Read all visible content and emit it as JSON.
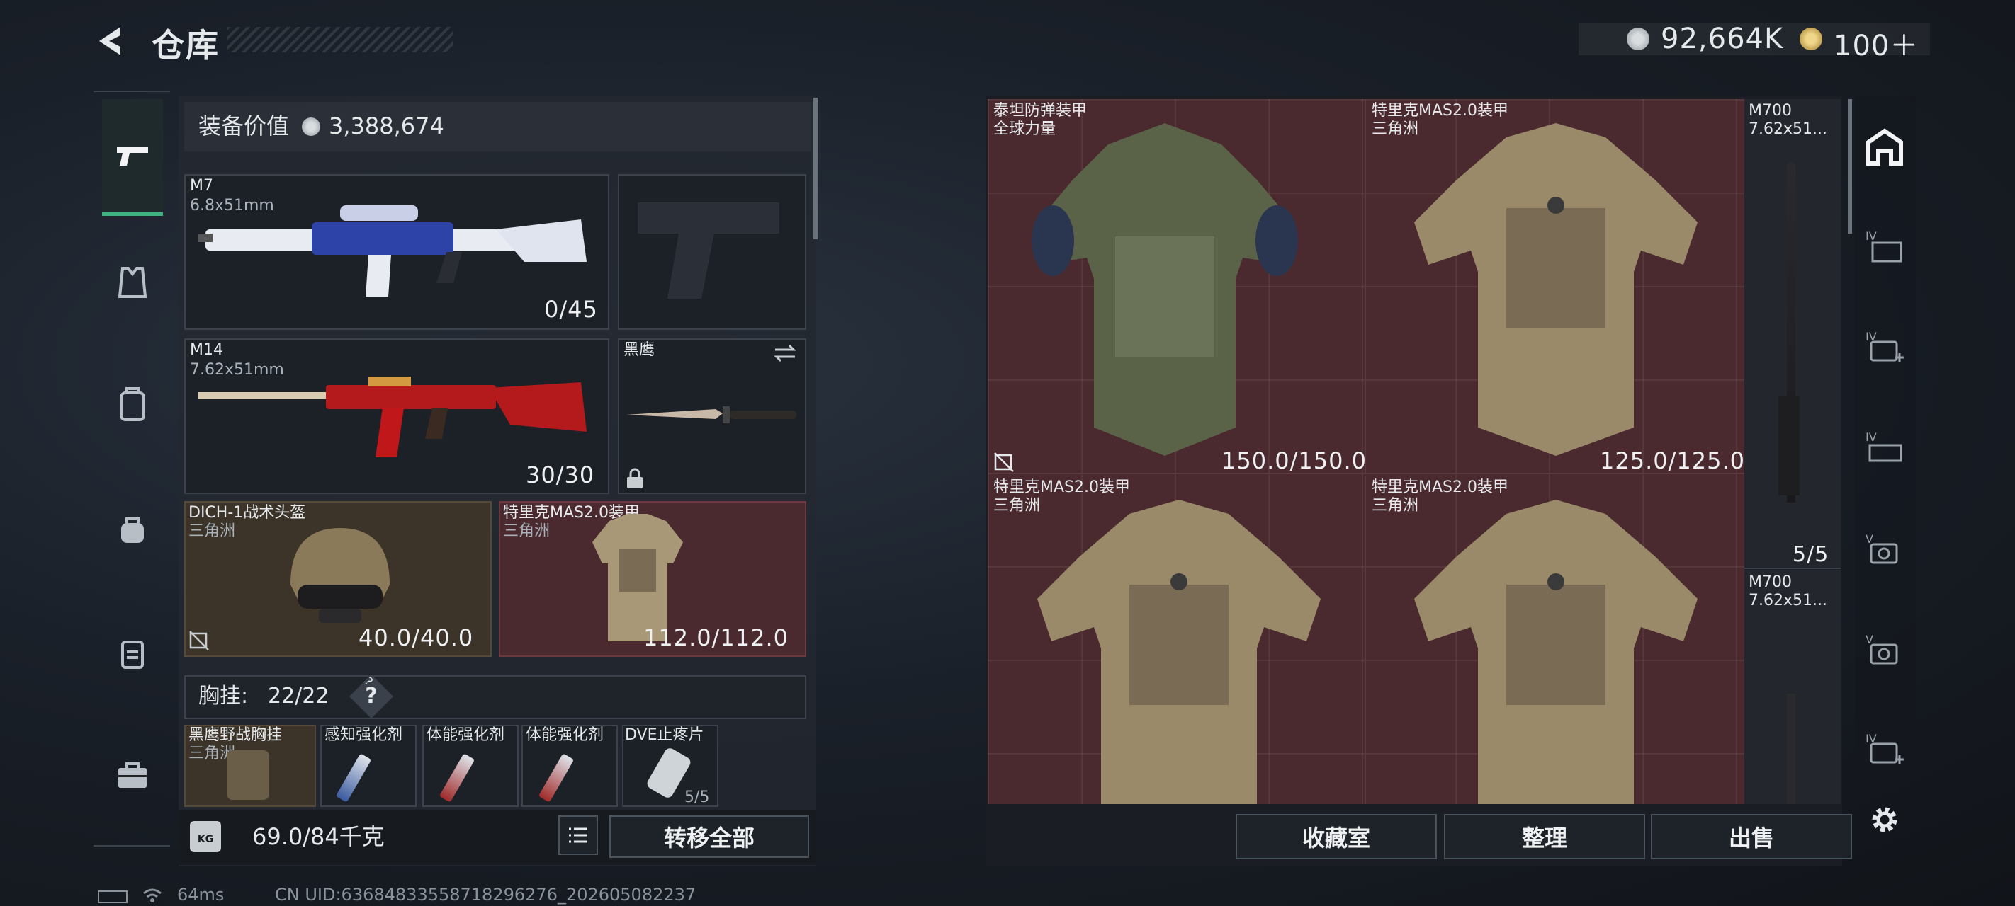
{
  "header": {
    "title": "仓库",
    "currency_silver": "92,664K",
    "currency_gold": "100＋"
  },
  "tabs": [
    {
      "icon": "pistol-icon",
      "active": true
    },
    {
      "icon": "armor-vest-icon",
      "active": false
    },
    {
      "icon": "backpack-icon",
      "active": false
    },
    {
      "icon": "bag-icon",
      "active": false
    },
    {
      "icon": "case-icon",
      "active": false
    },
    {
      "icon": "toolbox-icon",
      "active": false
    }
  ],
  "loadout": {
    "value_label": "装备价值",
    "value": "3,388,674",
    "primary": {
      "name": "M7",
      "caliber": "6.8x51mm",
      "ammo": "0/45"
    },
    "secondary": {
      "name": "M14",
      "caliber": "7.62x51mm",
      "ammo": "30/30"
    },
    "melee": {
      "name": "黑鹰"
    },
    "helmet": {
      "name": "DICH-1战术头盔",
      "origin": "三角洲",
      "durability": "40.0/40.0"
    },
    "armor": {
      "name": "特里克MAS2.0装甲",
      "origin": "三角洲",
      "durability": "112.0/112.0"
    },
    "chest_rig": {
      "label": "胸挂:",
      "capacity": "22/22",
      "help": "?"
    },
    "rig_items": [
      {
        "name": "黑鹰野战胸挂",
        "origin": "三角洲"
      },
      {
        "name": "感知强化剂"
      },
      {
        "name": "体能强化剂"
      },
      {
        "name": "体能强化剂"
      },
      {
        "name": "DVE止疼片",
        "count": "5/5"
      }
    ],
    "weight": "69.0/84千克",
    "weight_icon": "KG",
    "transfer_label": "转移全部"
  },
  "storage": {
    "items": [
      {
        "name": "泰坦防弹装甲",
        "origin": "全球力量",
        "durability": "150.0/150.0"
      },
      {
        "name": "特里克MAS2.0装甲",
        "origin": "三角洲",
        "durability": "125.0/125.0"
      },
      {
        "name": "特里克MAS2.0装甲",
        "origin": "三角洲"
      },
      {
        "name": "特里克MAS2.0装甲",
        "origin": "三角洲"
      }
    ],
    "rifles": [
      {
        "name": "M700",
        "caliber": "7.62x51...",
        "ammo": "5/5"
      },
      {
        "name": "M700",
        "caliber": "7.62x51..."
      }
    ],
    "buttons": {
      "collection": "收藏室",
      "sort": "整理",
      "sell": "出售"
    }
  },
  "side_tools": [
    {
      "icon": "home-icon",
      "tier": ""
    },
    {
      "icon": "crate-icon",
      "tier": "IV"
    },
    {
      "icon": "medkit-icon",
      "tier": "IV"
    },
    {
      "icon": "ammo-box-icon",
      "tier": "IV"
    },
    {
      "icon": "camera-case-icon",
      "tier": "V"
    },
    {
      "icon": "camera-case-icon",
      "tier": "V"
    },
    {
      "icon": "medkit-icon",
      "tier": "IV"
    }
  ],
  "status": {
    "ping": "64ms",
    "uid": "CN UID:6368483355871829627­6_202605082237"
  }
}
